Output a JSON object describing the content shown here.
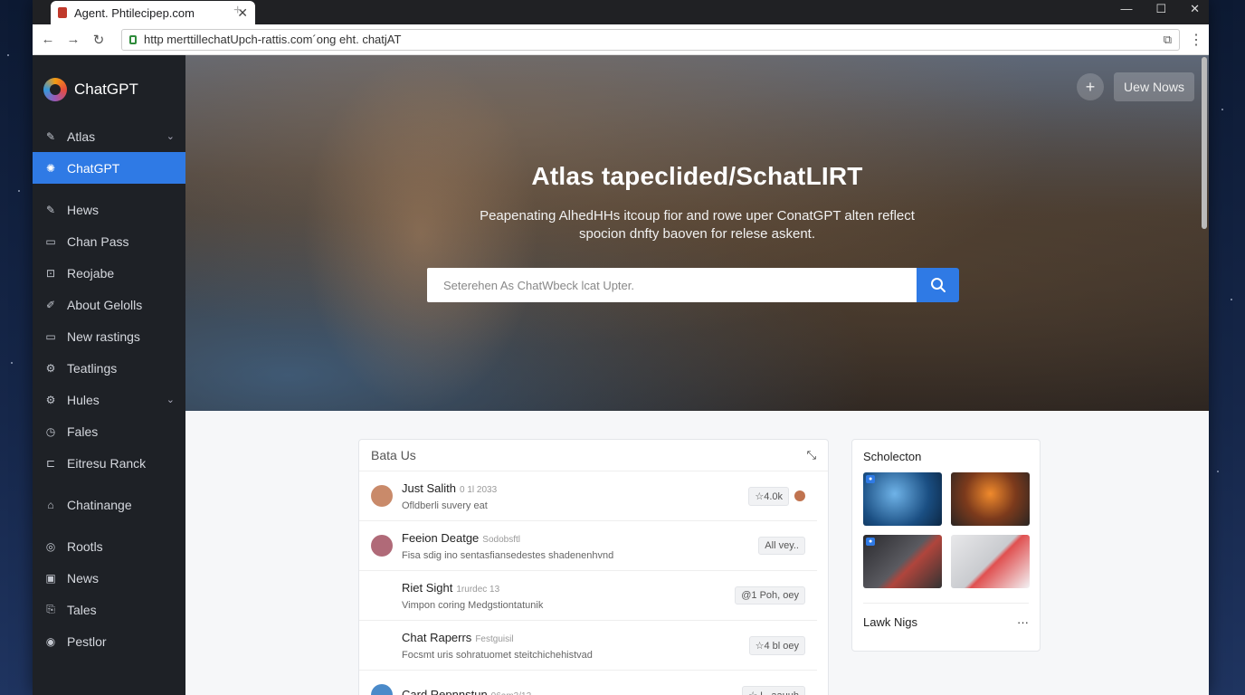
{
  "browser": {
    "tab_title": "Agent. Phtilecipep.com",
    "url": "http merttillechatUpch-rattis.com´ong eht. chatjAT"
  },
  "sidebar": {
    "brand": "ChatGPT",
    "items": [
      {
        "label": "Atlas",
        "icon": "pen-icon",
        "chevron": true
      },
      {
        "label": "ChatGPT",
        "icon": "gear-icon",
        "active": true
      },
      {
        "label": "Hews",
        "icon": "edit-icon"
      },
      {
        "label": "Chan Pass",
        "icon": "square-icon"
      },
      {
        "label": "Reojabe",
        "icon": "lock-icon"
      },
      {
        "label": "About Gelolls",
        "icon": "compass-icon"
      },
      {
        "label": "New rastings",
        "icon": "folder-icon"
      },
      {
        "label": "Teatlings",
        "icon": "settings-icon"
      },
      {
        "label": "Hules",
        "icon": "settings-alt-icon",
        "chevron": true
      },
      {
        "label": "Fales",
        "icon": "clock-icon"
      },
      {
        "label": "Eitresu Ranck",
        "icon": "box-icon"
      },
      {
        "label": "Chatinange",
        "icon": "building-icon"
      },
      {
        "label": "Rootls",
        "icon": "circle-icon"
      },
      {
        "label": "News",
        "icon": "news-icon"
      },
      {
        "label": "Tales",
        "icon": "doc-icon"
      },
      {
        "label": "Pestlor",
        "icon": "target-icon"
      }
    ]
  },
  "hero": {
    "title": "Atlas tapeclided/SchatLIRT",
    "subtitle_line1": "Peapenating AlhedHHs itcoup fior and rowe uper ConatGPT alten reflect",
    "subtitle_line2": "spocion dnfty baoven for relese askent.",
    "search_placeholder": "Seterehen As ChatWbeck lcat Upter.",
    "new_button": "Uew Nows"
  },
  "feed": {
    "title": "Bata Us",
    "rows": [
      {
        "name": "Just Salith",
        "meta": "0 1l 2033",
        "desc": "Ofldberli suvery eat",
        "tag": "☆4.0k",
        "avatar_color": "#c98a6a",
        "dot": true
      },
      {
        "name": "Feeion Deatge",
        "meta": "Sodobsftl",
        "desc": "Fisa sdig ino sentasfiansedestes shadenenhvnd",
        "tag": "All vey..",
        "avatar_color": "#b06a78"
      },
      {
        "name": "Riet Sight",
        "meta": "1rurdec 13",
        "desc": "Vimpon coring Medgstiontatunik",
        "tag": "@1 Poh, oey"
      },
      {
        "name": "Chat Raperrs",
        "meta": "Festguisil",
        "desc": "Focsmt uris sohratuomet steitchichehistvad",
        "tag": "☆4 bl oey"
      },
      {
        "name": "Card Repnnstun",
        "meta": "06am3/12",
        "desc": "",
        "tag": "☆ L. aauuh",
        "avatar_color": "#4a8ac9"
      }
    ]
  },
  "collection": {
    "title": "Scholecton",
    "footer": "Lawk Nigs",
    "more": "···"
  }
}
